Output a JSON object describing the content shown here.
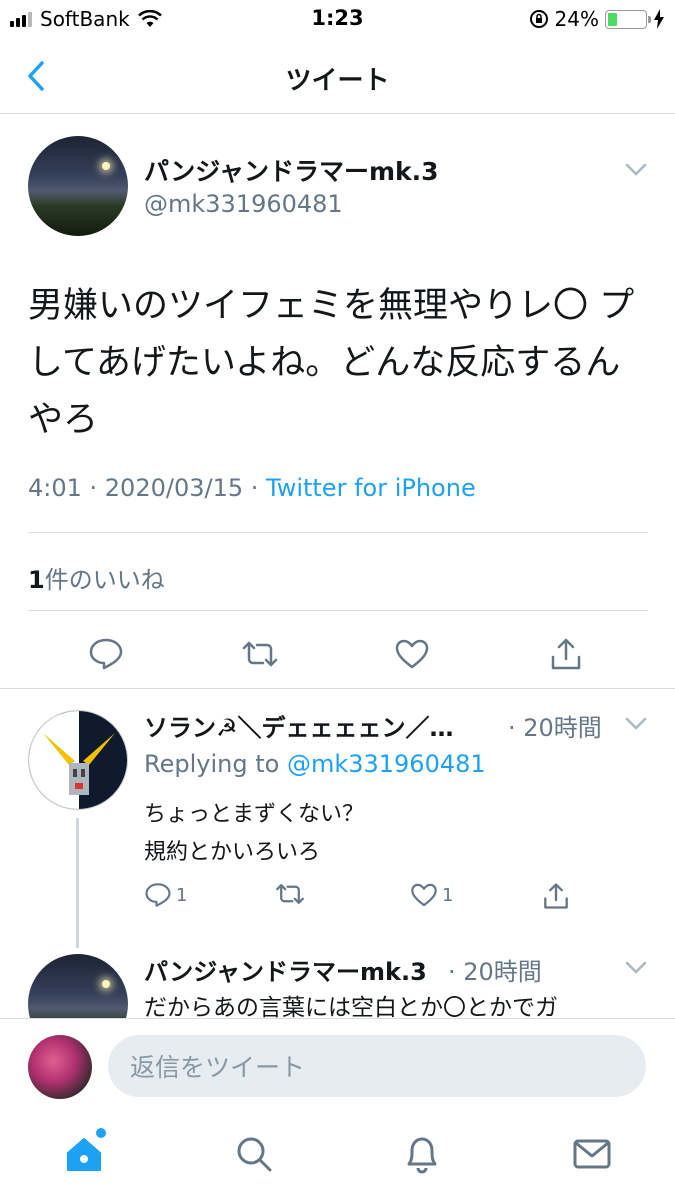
{
  "status_bar": {
    "carrier": "SoftBank",
    "time": "1:23",
    "battery": "24%",
    "battery_level": 0.24
  },
  "nav": {
    "title": "ツイート"
  },
  "tweet": {
    "display_name": "パンジャンドラマーmk.3",
    "handle": "@mk331960481",
    "text": "男嫌いのツイフェミを無理やりレ〇 プしてあげたいよね。どんな反応するんやろ",
    "time": "4:01 · 2020/03/15 · ",
    "source": "Twitter for iPhone",
    "likes_count": "1",
    "likes_label": "件のいいね"
  },
  "replies": [
    {
      "display_name": "ソラン☭＼デェェェェン／…",
      "time": "· 20時間",
      "replying_prefix": "Replying to ",
      "replying_to": "@mk331960481",
      "text": "ちょっとまずくない？\n規約とかいろいろ",
      "reply_count": "1",
      "retweet_count": "",
      "like_count": "1"
    },
    {
      "display_name": "パンジャンドラマーmk.3",
      "time": "· 20時間",
      "text": "だからあの言葉には空白とか〇とかでガ"
    }
  ],
  "composer": {
    "placeholder": "返信をツイート"
  },
  "colors": {
    "accent": "#1da1f2",
    "secondary_text": "#657786",
    "divider": "#d7dde2"
  }
}
